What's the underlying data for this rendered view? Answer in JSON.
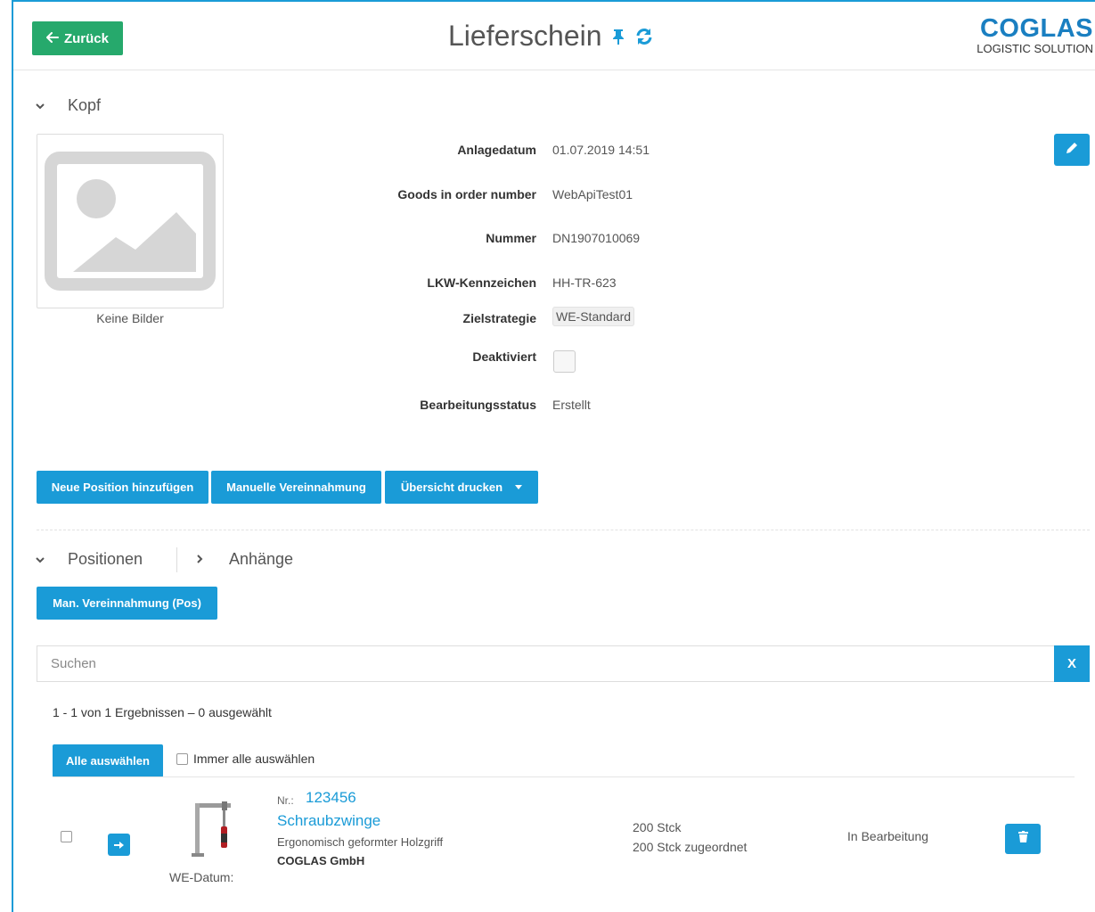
{
  "header": {
    "back_label": "Zurück",
    "title": "Lieferschein",
    "logo_main": "COGLAS",
    "logo_sub": "LOGISTIC SOLUTION"
  },
  "kopf": {
    "section_label": "Kopf",
    "no_images": "Keine Bilder",
    "fields": {
      "anlagedatum_label": "Anlagedatum",
      "anlagedatum_value": "01.07.2019 14:51",
      "goods_in_label": "Goods in order number",
      "goods_in_value": "WebApiTest01",
      "nummer_label": "Nummer",
      "nummer_value": "DN1907010069",
      "lkw_label": "LKW-Kennzeichen",
      "lkw_value": "HH-TR-623",
      "ziel_label": "Zielstrategie",
      "ziel_value": "WE-Standard",
      "deaktiviert_label": "Deaktiviert",
      "deaktiviert_checked": false,
      "status_label": "Bearbeitungsstatus",
      "status_value": "Erstellt"
    }
  },
  "actions": {
    "neue_position": "Neue Position hinzufügen",
    "manuelle_vereinnahmung": "Manuelle Vereinnahmung",
    "uebersicht_drucken": "Übersicht drucken"
  },
  "tabs": {
    "positionen": "Positionen",
    "anhaenge": "Anhänge"
  },
  "positionen": {
    "man_vereinnahmung_pos": "Man. Vereinnahmung (Pos)",
    "search_placeholder": "Suchen",
    "search_clear": "X",
    "results_text": "1 - 1 von 1 Ergebnissen  –  0 ausgewählt",
    "select_all": "Alle auswählen",
    "always_select_all": "Immer alle auswählen",
    "rows": [
      {
        "nr_label": "Nr.:",
        "nr": "123456",
        "name": "Schraubzwinge",
        "description": "Ergonomisch geformter Holzgriff",
        "company": "COGLAS GmbH",
        "we_datum_label": "WE-Datum:",
        "qty": "200 Stck",
        "qty_assigned": "200 Stck zugeordnet",
        "state": "In Bearbeitung"
      }
    ]
  },
  "colors": {
    "primary": "#1a9bd7",
    "success": "#26a96c",
    "logo": "#1a7fc1"
  }
}
